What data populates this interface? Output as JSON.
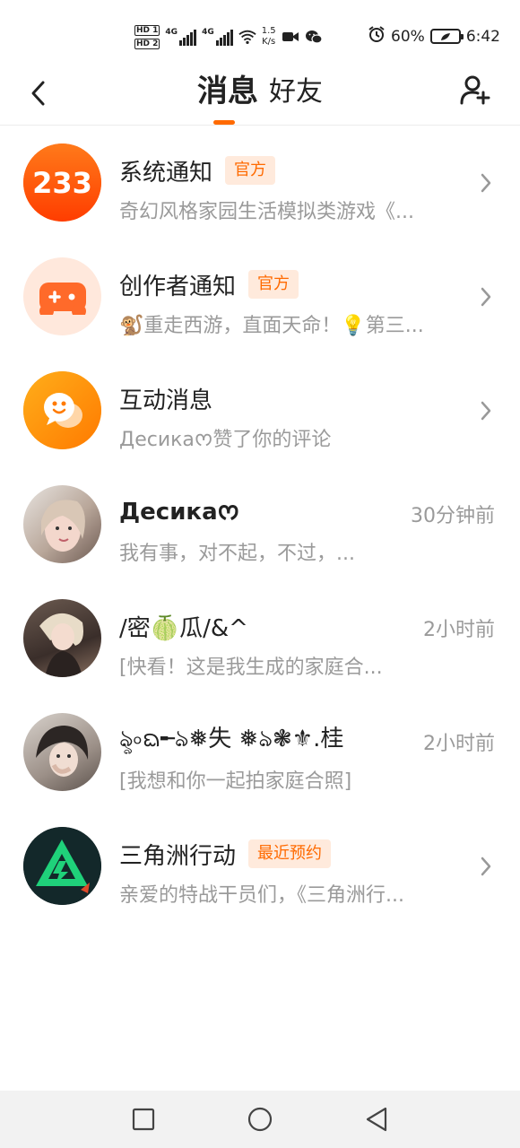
{
  "status_bar": {
    "sim1": "HD 1",
    "sim2": "HD 2",
    "net1": "4G",
    "net2": "4G",
    "speed_value": "1.5",
    "speed_unit": "K/s",
    "battery": "60%",
    "time": "6:42"
  },
  "header": {
    "tab_active": "消息",
    "tab_inactive": "好友"
  },
  "colors": {
    "accent": "#ff6a00",
    "badge_bg": "#ffeadc"
  },
  "messages": [
    {
      "title": "系统通知",
      "badge": "官方",
      "subtitle": "奇幻风格家园生活模拟类游戏《...",
      "time": "",
      "avatar_icon": "logo-233-icon"
    },
    {
      "title": "创作者通知",
      "badge": "官方",
      "subtitle": "🐒重走西游，直面天命！💡第三...",
      "time": "",
      "avatar_icon": "gamepad-icon"
    },
    {
      "title": "互动消息",
      "badge": "",
      "subtitle": "Десикаᰔ赞了你的评论",
      "time": "",
      "avatar_icon": "chat-bubble-icon"
    },
    {
      "title": "Десикаᰔ",
      "badge": "",
      "subtitle": "我有事，对不起，不过，...",
      "time": "30分钟前",
      "avatar_icon": "user-photo"
    },
    {
      "title": "/密🍈瓜/&^",
      "badge": "",
      "subtitle": "[快看！这是我生成的家庭合...",
      "time": "2小时前",
      "avatar_icon": "user-photo"
    },
    {
      "title": "ৡ৹ᨳ╾ঌ❅失 ❅ঌ❃⚜.桂",
      "badge": "",
      "subtitle": "[我想和你一起拍家庭合照]",
      "time": "2小时前",
      "avatar_icon": "user-photo"
    },
    {
      "title": "三角洲行动",
      "badge": "最近预约",
      "subtitle": "亲爱的特战干员们，《三角洲行...",
      "time": "",
      "avatar_icon": "delta-force-logo"
    }
  ]
}
